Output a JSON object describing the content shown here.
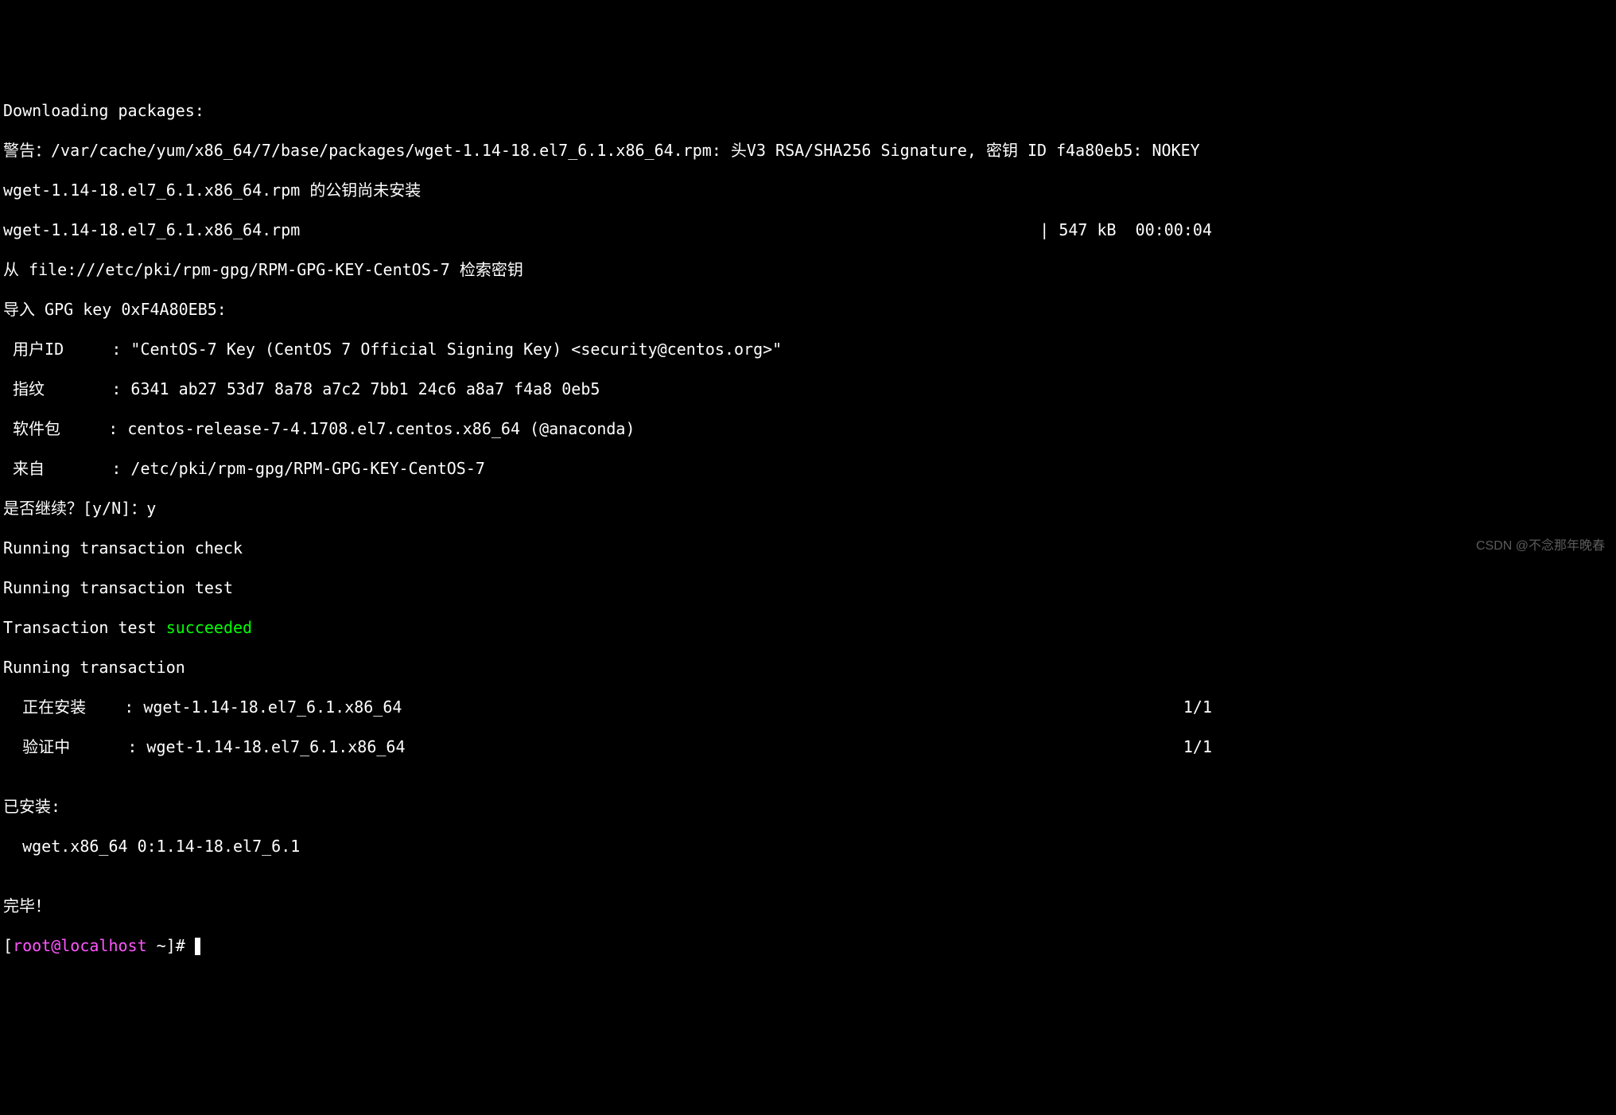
{
  "term": {
    "l1": "Downloading packages:",
    "l2": "警告：/var/cache/yum/x86_64/7/base/packages/wget-1.14-18.el7_6.1.x86_64.rpm: 头V3 RSA/SHA256 Signature, 密钥 ID f4a80eb5: NOKEY",
    "l3": "wget-1.14-18.el7_6.1.x86_64.rpm 的公钥尚未安装",
    "l4_left": "wget-1.14-18.el7_6.1.x86_64.rpm",
    "l4_right": "| 547 kB  00:00:04",
    "l5": "从 file:///etc/pki/rpm-gpg/RPM-GPG-KEY-CentOS-7 检索密钥",
    "l6": "导入 GPG key 0xF4A80EB5:",
    "l7": " 用户ID     : \"CentOS-7 Key (CentOS 7 Official Signing Key) <security@centos.org>\"",
    "l8": " 指纹       : 6341 ab27 53d7 8a78 a7c2 7bb1 24c6 a8a7 f4a8 0eb5",
    "l9": " 软件包     : centos-release-7-4.1708.el7.centos.x86_64 (@anaconda)",
    "l10": " 来自       : /etc/pki/rpm-gpg/RPM-GPG-KEY-CentOS-7",
    "l11": "是否继续？[y/N]：y",
    "l12": "Running transaction check",
    "l13": "Running transaction test",
    "l14a": "Transaction test ",
    "l14b": "succeeded",
    "l15": "Running transaction",
    "l16_left": "  正在安装    : wget-1.14-18.el7_6.1.x86_64",
    "l16_right": "1/1",
    "l17_left": "  验证中      : wget-1.14-18.el7_6.1.x86_64",
    "l17_right": "1/1",
    "l18": "",
    "l19": "已安装:",
    "l20": "  wget.x86_64 0:1.14-18.el7_6.1",
    "l21": "",
    "l22": "完毕！",
    "prompt_open": "[",
    "prompt_user": "root",
    "prompt_at": "@",
    "prompt_host": "localhost",
    "prompt_tail": " ~]# "
  },
  "watermark": "CSDN @不念那年晚春"
}
